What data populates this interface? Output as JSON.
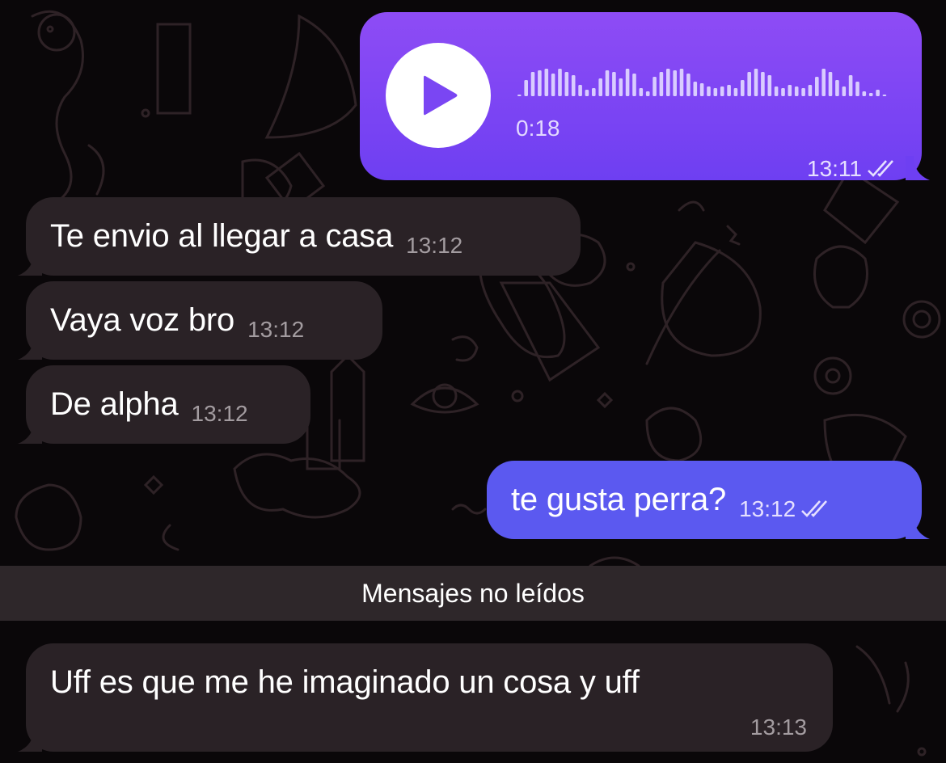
{
  "theme": {
    "background": "#0a0709",
    "incoming_bubble": "#2a2226",
    "outgoing_bubble": "#5b59f0",
    "voice_bubble_top": "#8e4cf5",
    "voice_bubble_bottom": "#6e3ff2"
  },
  "voice_message": {
    "icon": "play-icon",
    "duration": "0:18",
    "time": "13:11",
    "status_icon": "double-check-icon"
  },
  "messages": [
    {
      "text": "Te envio al llegar a casa",
      "time": "13:12",
      "direction": "incoming"
    },
    {
      "text": "Vaya voz bro",
      "time": "13:12",
      "direction": "incoming"
    },
    {
      "text": "De alpha",
      "time": "13:12",
      "direction": "incoming"
    },
    {
      "text": "te gusta perra?",
      "time": "13:12",
      "direction": "outgoing",
      "status_icon": "double-check-icon"
    },
    {
      "text": "Uff es que me he imaginado un cosa y uff",
      "time": "13:13",
      "direction": "incoming"
    }
  ],
  "unread_divider": {
    "label": "Mensajes no leídos"
  }
}
